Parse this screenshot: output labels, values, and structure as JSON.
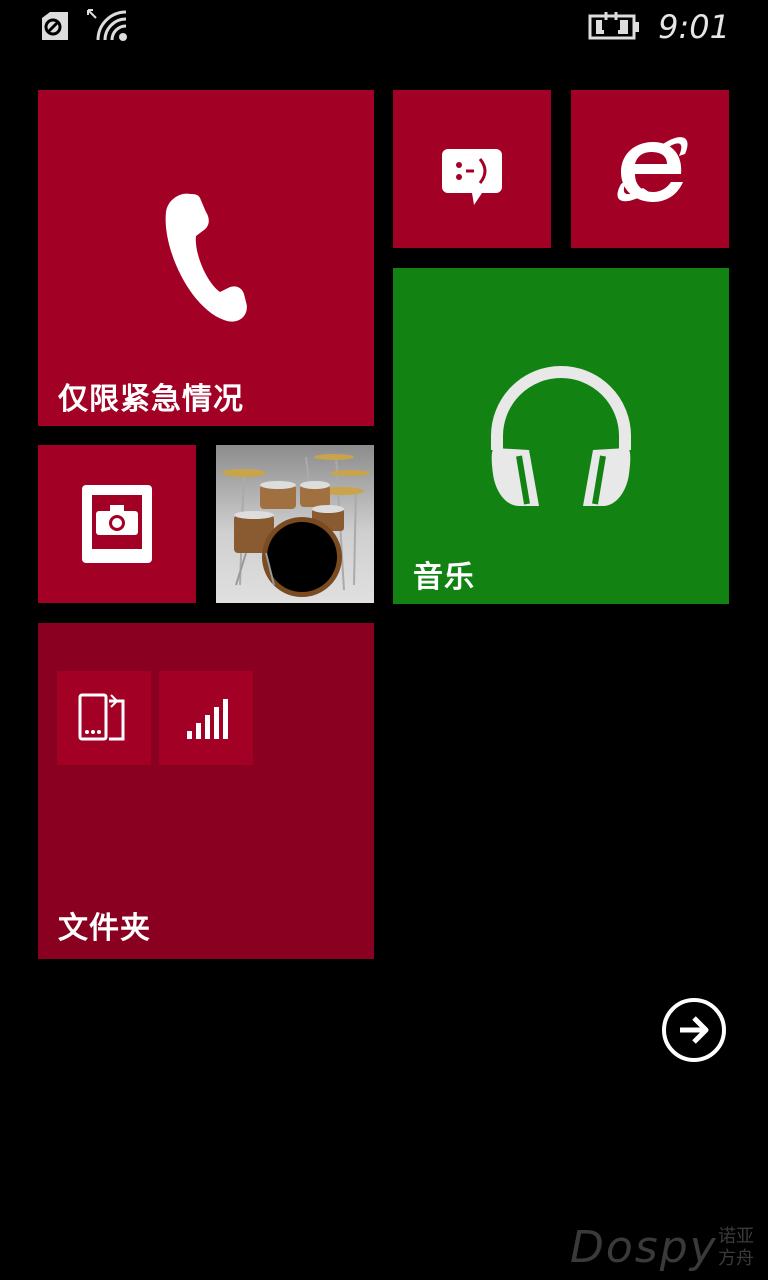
{
  "status_bar": {
    "time": "9:01",
    "icons": [
      "sim-icon",
      "data-arrow-icon",
      "wifi-icon",
      "battery-charging-icon"
    ]
  },
  "tiles": {
    "phone": {
      "label": "仅限紧急情况",
      "icon": "phone-icon",
      "color": "#a20025"
    },
    "messaging": {
      "icon": "messaging-icon",
      "color": "#a20025"
    },
    "internet_explorer": {
      "icon": "internet-explorer-icon",
      "color": "#a20025"
    },
    "music": {
      "label": "音乐",
      "icon": "headphones-icon",
      "color": "#128313"
    },
    "camera": {
      "icon": "camera-icon",
      "color": "#a20025"
    },
    "photos": {
      "icon": "drum-kit-photo"
    },
    "folder": {
      "label": "文件夹",
      "color": "#8a0021",
      "items": [
        "phone-transfer-icon",
        "signal-bars-icon"
      ]
    }
  },
  "navigation": {
    "app_list_arrow": "arrow-right-icon"
  },
  "watermark": {
    "brand": "Dospy",
    "line1": "诺亚",
    "line2": "方舟"
  }
}
